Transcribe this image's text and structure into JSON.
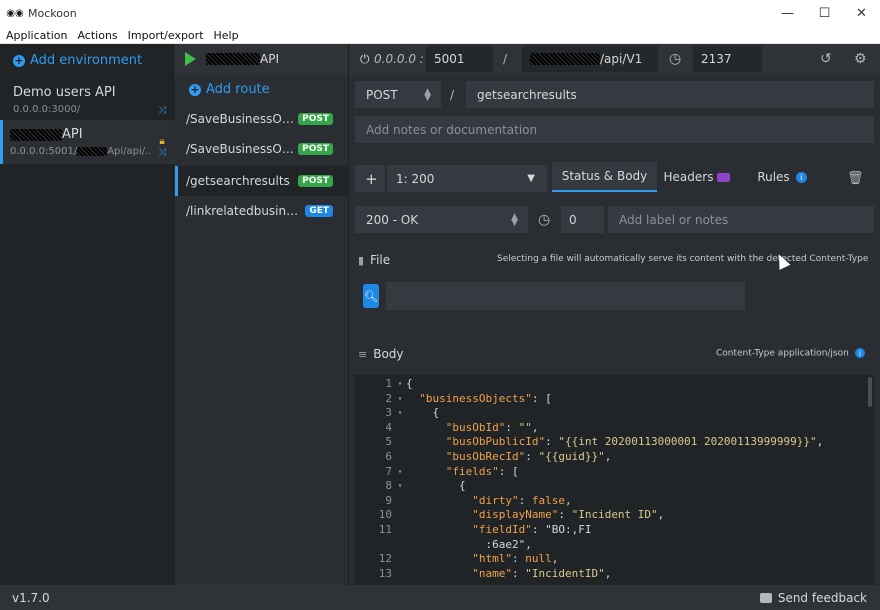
{
  "window": {
    "title": "Mockoon",
    "minimize": "—",
    "maximize": "☐",
    "close": "✕"
  },
  "menu": [
    "Application",
    "Actions",
    "Import/export",
    "Help"
  ],
  "environments": {
    "add_label": "Add environment",
    "items": [
      {
        "name": "Demo users API",
        "address": "0.0.0.0:3000/"
      },
      {
        "name": "API",
        "address": "0.0.0.0:5001/",
        "address_suffix": "Api/api/..."
      }
    ]
  },
  "routes": {
    "env_title": "API",
    "add_label": "Add route",
    "items": [
      {
        "path": "/SaveBusinessObj...",
        "method": "POST"
      },
      {
        "path": "/SaveBusinessObj...",
        "method": "POST"
      },
      {
        "path": "/getsearchresults",
        "method": "POST"
      },
      {
        "path": "/linkrelatedbusine...",
        "method": "GET"
      }
    ]
  },
  "topbar": {
    "hostname_placeholder": "0.0.0.0 :",
    "port": "5001",
    "slash": "/",
    "prefix_suffix": "/api/V1",
    "latency": "2137"
  },
  "route_editor": {
    "method": "POST",
    "slash": "/",
    "path": "getsearchresults",
    "notes_placeholder": "Add notes or documentation",
    "response_select": "1: 200",
    "tabs": {
      "status_body": "Status & Body",
      "headers": "Headers",
      "rules": "Rules"
    },
    "status": "200 - OK",
    "delay": "0",
    "label_placeholder": "Add label or notes",
    "file_label": "File",
    "file_note": "Selecting a file will automatically serve its content with the detected Content-Type",
    "body_label": "Body",
    "content_type_note": "Content-Type application/json"
  },
  "code_lines": [
    {
      "n": "1",
      "fold": "▾",
      "text": "{"
    },
    {
      "n": "2",
      "fold": "▾",
      "text": "  \"businessObjects\": ["
    },
    {
      "n": "3",
      "fold": "▾",
      "text": "    {"
    },
    {
      "n": "4",
      "fold": "",
      "text": "      \"busObId\": \"\","
    },
    {
      "n": "5",
      "fold": "",
      "text": "      \"busObPublicId\": \"{{int 20200113000001 20200113999999}}\","
    },
    {
      "n": "6",
      "fold": "",
      "text": "      \"busObRecId\": \"{{guid}}\","
    },
    {
      "n": "7",
      "fold": "▾",
      "text": "      \"fields\": ["
    },
    {
      "n": "8",
      "fold": "▾",
      "text": "        {"
    },
    {
      "n": "9",
      "fold": "",
      "text": "          \"dirty\": false,"
    },
    {
      "n": "10",
      "fold": "",
      "text": "          \"displayName\": \"Incident ID\","
    },
    {
      "n": "11",
      "fold": "",
      "text": "          \"fieldId\": \"BO:,FI"
    },
    {
      "n": "",
      "fold": "",
      "text": "            :6ae2\","
    },
    {
      "n": "12",
      "fold": "",
      "text": "          \"html\": null,"
    },
    {
      "n": "13",
      "fold": "",
      "text": "          \"name\": \"IncidentID\","
    }
  ],
  "footer": {
    "version": "v1.7.0",
    "feedback": "Send feedback"
  },
  "colors": {
    "accent": "#2f9bf1",
    "post": "#35a647",
    "get": "#1e88e5",
    "play": "#3fbf4a"
  }
}
